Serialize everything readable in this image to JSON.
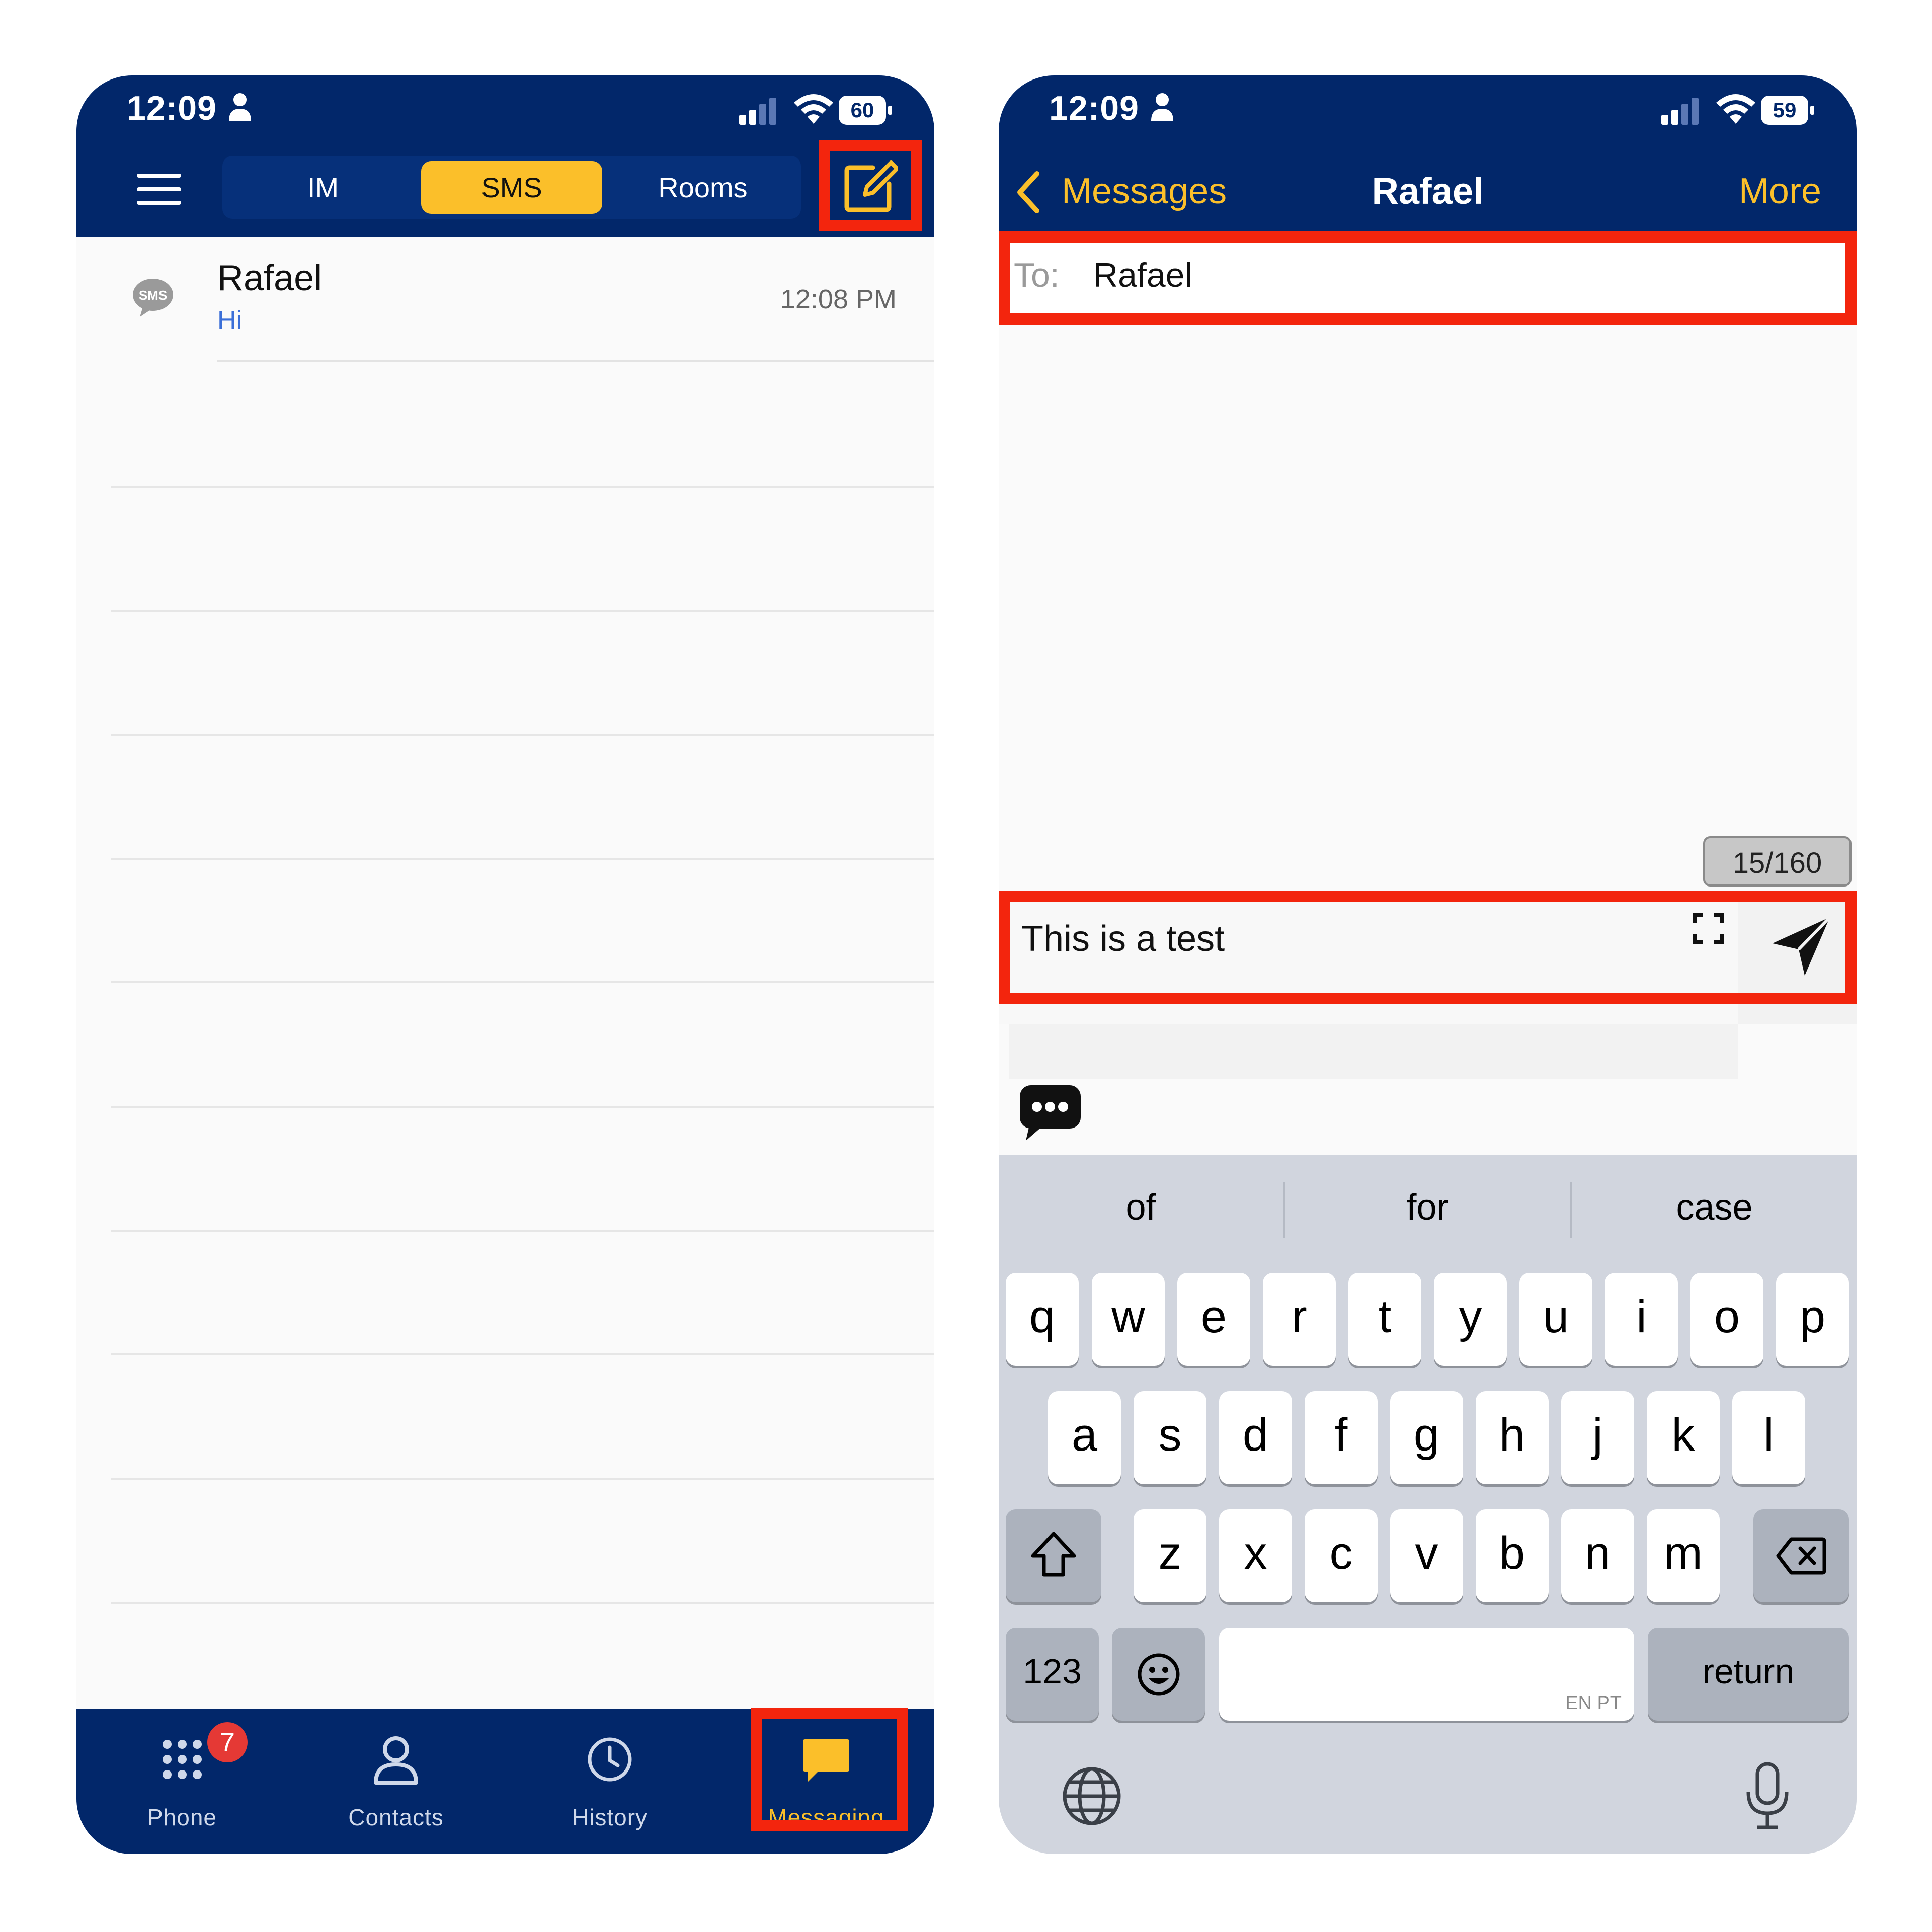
{
  "left_screen": {
    "status": {
      "time": "12:09",
      "battery": "60"
    },
    "segments": [
      "IM",
      "SMS",
      "Rooms"
    ],
    "active_segment": "SMS",
    "conversations": [
      {
        "name": "Rafael",
        "preview": "Hi",
        "time": "12:08 PM",
        "badge": "SMS"
      }
    ],
    "tabbar": {
      "items": [
        "Phone",
        "Contacts",
        "History",
        "Messaging"
      ],
      "active": "Messaging",
      "phone_badge": "7"
    }
  },
  "right_screen": {
    "status": {
      "time": "12:09",
      "battery": "59"
    },
    "header": {
      "back_label": "Messages",
      "title": "Rafael",
      "more_label": "More"
    },
    "to_field": {
      "label": "To:",
      "value": "Rafael"
    },
    "char_counter": "15/160",
    "compose_text": "This is a test",
    "keyboard": {
      "suggestions": [
        "of",
        "for",
        "case"
      ],
      "row1": [
        "q",
        "w",
        "e",
        "r",
        "t",
        "y",
        "u",
        "i",
        "o",
        "p"
      ],
      "row2": [
        "a",
        "s",
        "d",
        "f",
        "g",
        "h",
        "j",
        "k",
        "l"
      ],
      "row3": [
        "z",
        "x",
        "c",
        "v",
        "b",
        "n",
        "m"
      ],
      "numbers_key": "123",
      "return_key": "return",
      "space_language": "EN PT"
    }
  },
  "colors": {
    "navy": "#02276a",
    "accent_yellow": "#fbbf2a",
    "highlight_red": "#f3250d"
  }
}
